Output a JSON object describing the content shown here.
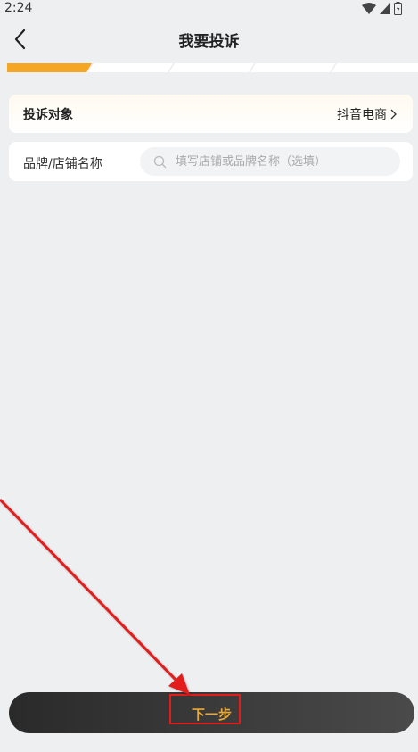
{
  "status_bar": {
    "time": "2:24",
    "icons": [
      "wifi-icon",
      "signal-icon",
      "battery-icon"
    ]
  },
  "nav": {
    "title": "我要投诉",
    "back_icon": "chevron-left-icon"
  },
  "progress": {
    "total_steps": 5,
    "current_step": 1,
    "active_color": "#f5a623",
    "inactive_color": "#ffffff"
  },
  "form": {
    "complaint_target": {
      "label": "投诉对象",
      "value": "抖音电商"
    },
    "brand_store": {
      "label": "品牌/店铺名称",
      "placeholder": "填写店铺或品牌名称（选填）",
      "value": ""
    }
  },
  "footer": {
    "next_label": "下一步"
  },
  "annotation": {
    "color": "#e31b1b"
  }
}
